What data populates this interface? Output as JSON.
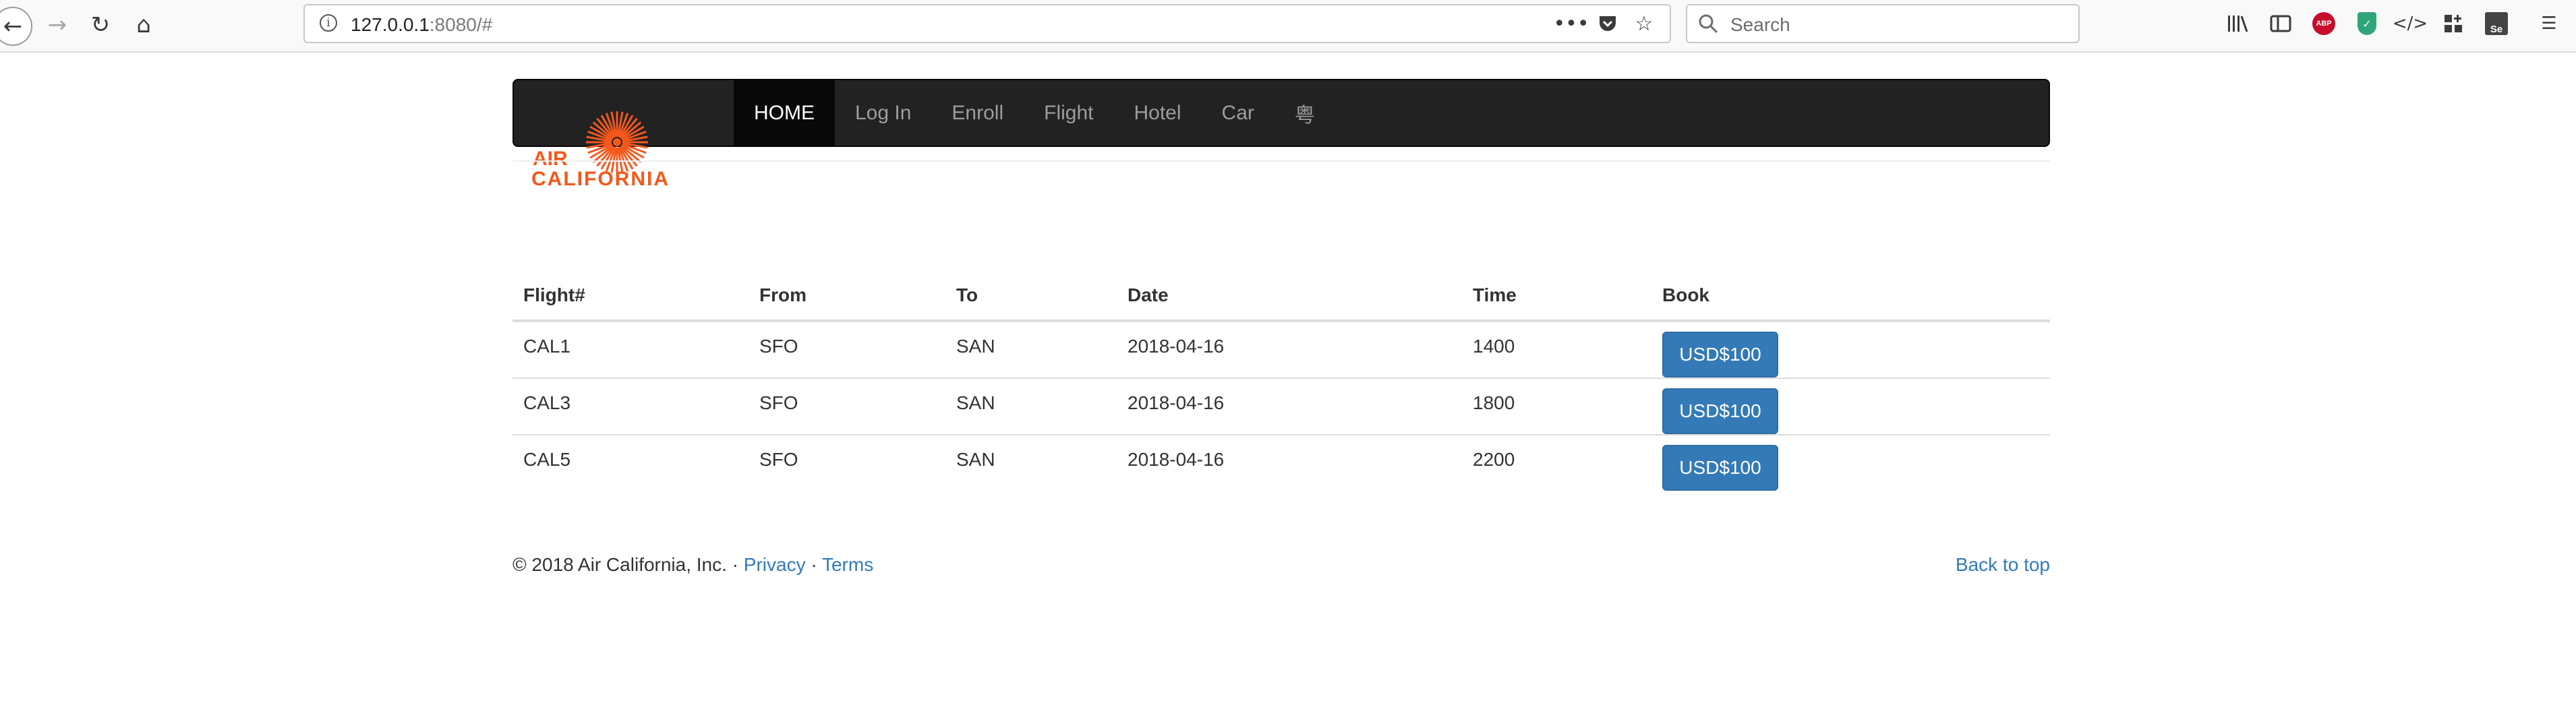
{
  "browser": {
    "url_host": "127.0.0.1",
    "url_rest": ":8080/#",
    "search_placeholder": "Search",
    "abp_label": "ABP",
    "se_label": "Se"
  },
  "navbar": {
    "logo_line1": "AIR",
    "logo_line2": "CALIFORNIA",
    "items": [
      {
        "label": "HOME",
        "active": true
      },
      {
        "label": "Log In"
      },
      {
        "label": "Enroll"
      },
      {
        "label": "Flight"
      },
      {
        "label": "Hotel"
      },
      {
        "label": "Car"
      },
      {
        "label": "粤"
      }
    ]
  },
  "flights": {
    "headers": [
      "Flight#",
      "From",
      "To",
      "Date",
      "Time",
      "Book"
    ],
    "rows": [
      {
        "flight": "CAL1",
        "from": "SFO",
        "to": "SAN",
        "date": "2018-04-16",
        "time": "1400",
        "price": "USD$100"
      },
      {
        "flight": "CAL3",
        "from": "SFO",
        "to": "SAN",
        "date": "2018-04-16",
        "time": "1800",
        "price": "USD$100"
      },
      {
        "flight": "CAL5",
        "from": "SFO",
        "to": "SAN",
        "date": "2018-04-16",
        "time": "2200",
        "price": "USD$100"
      }
    ]
  },
  "footer": {
    "copyright": "© 2018 Air California, Inc. · ",
    "privacy": "Privacy",
    "sep": " · ",
    "terms": "Terms",
    "back_to_top": "Back to top"
  },
  "colors": {
    "navbar_bg": "#222222",
    "link": "#337ab7",
    "button": "#337ab7",
    "logo_orange": "#f4581c"
  }
}
